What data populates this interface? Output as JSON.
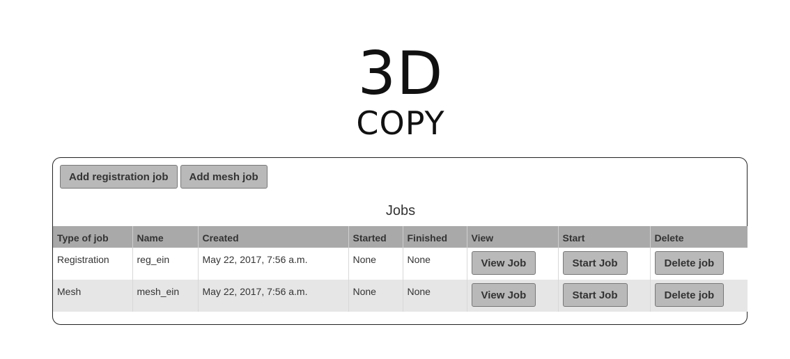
{
  "logo": {
    "line1": "3D",
    "line2": "COPY"
  },
  "toolbar": {
    "add_registration_label": "Add registration job",
    "add_mesh_label": "Add mesh job"
  },
  "jobs": {
    "title": "Jobs",
    "columns": [
      "Type of job",
      "Name",
      "Created",
      "Started",
      "Finished",
      "View",
      "Start",
      "Delete"
    ],
    "rows": [
      {
        "type": "Registration",
        "name": "reg_ein",
        "created": "May 22, 2017, 7:56 a.m.",
        "started": "None",
        "finished": "None",
        "view_label": "View Job",
        "start_label": "Start Job",
        "delete_label": "Delete job"
      },
      {
        "type": "Mesh",
        "name": "mesh_ein",
        "created": "May 22, 2017, 7:56 a.m.",
        "started": "None",
        "finished": "None",
        "view_label": "View Job",
        "start_label": "Start Job",
        "delete_label": "Delete job"
      }
    ]
  },
  "colors": {
    "header_bg": "#a9a9a9",
    "button_bg": "#b9b9b9",
    "alt_row_bg": "#e6e6e6",
    "text": "#333333"
  }
}
